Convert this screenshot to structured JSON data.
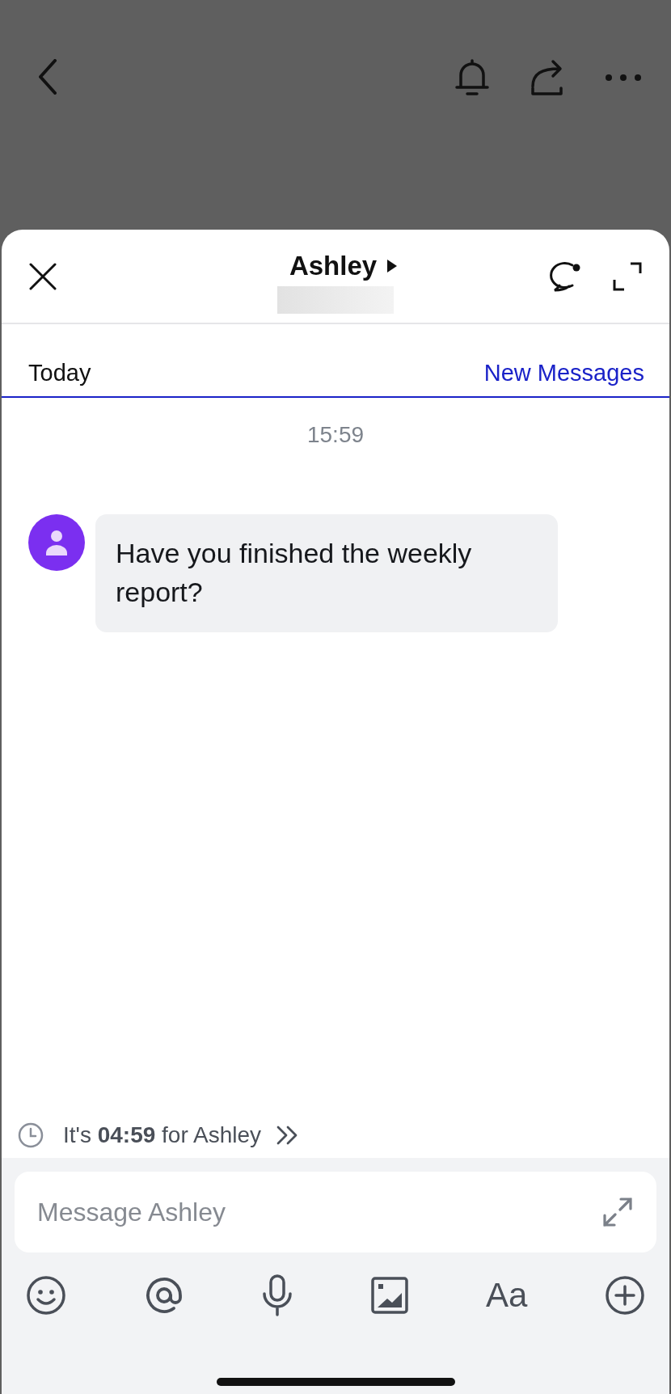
{
  "sheet": {
    "title": "Ashley"
  },
  "divider": {
    "left": "Today",
    "right": "New Messages"
  },
  "messages": [
    {
      "time": "15:59",
      "text": "Have you finished the weekly report?"
    }
  ],
  "timezone_note": "It's **04:59** for Ashley",
  "composer": {
    "placeholder": "Message Ashley"
  },
  "toolbar": [
    {
      "kind": "emoji"
    },
    {
      "kind": "mention"
    },
    {
      "kind": "mic"
    },
    {
      "kind": "image"
    },
    {
      "kind": "format",
      "label": "Aa"
    },
    {
      "kind": "plus"
    }
  ]
}
